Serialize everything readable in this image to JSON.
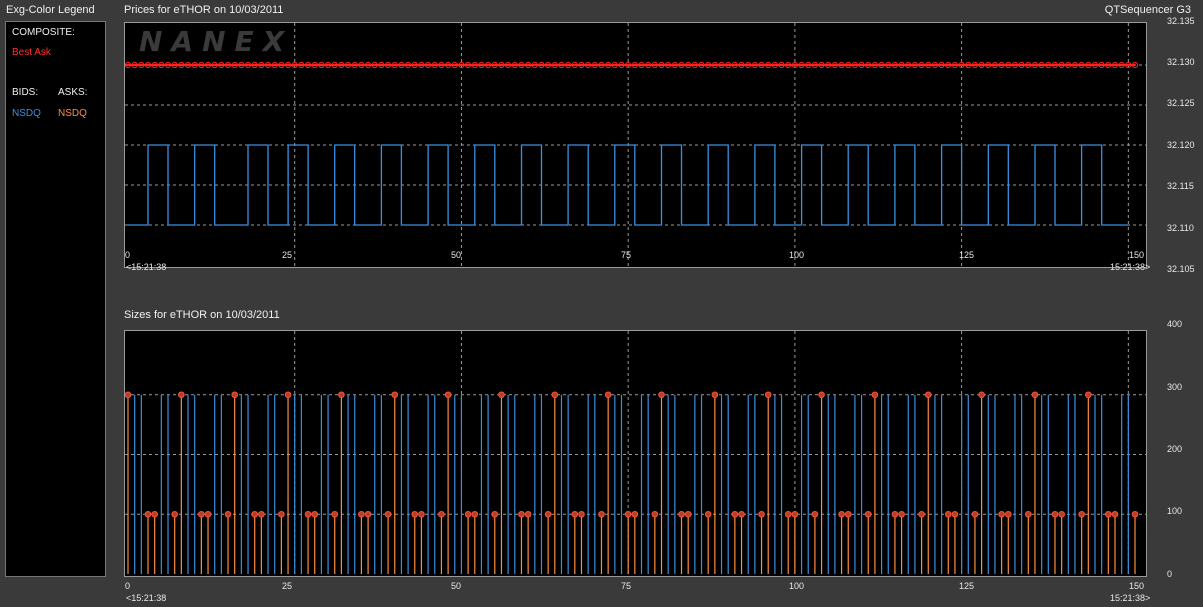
{
  "legend": {
    "title": "Exg-Color Legend",
    "composite_label": "COMPOSITE:",
    "best_ask": "Best Ask",
    "bids_label": "BIDS:",
    "asks_label": "ASKS:",
    "bid_exchange": "NSDQ",
    "ask_exchange": "NSDQ"
  },
  "header": {
    "price_title": "Prices for  eTHOR  on  10/03/2011",
    "app_name": "QTSequencer G3",
    "size_title": "Sizes for  eTHOR  on  10/03/2011"
  },
  "watermark": "NANEX",
  "time_start": "<15:21:38",
  "time_end": "15:21:38>",
  "colors": {
    "bid": "#3a8fe0",
    "ask": "#ff8c40",
    "best_ask": "#ff2020",
    "grid": "#9a9a9a",
    "background": "#000000"
  },
  "chart_data": [
    {
      "type": "line",
      "title": "Prices for  eTHOR  on  10/03/2011",
      "x_ticks": [
        "0",
        "25",
        "50",
        "75",
        "100",
        "125",
        "150"
      ],
      "xlim": [
        0,
        151
      ],
      "y_ticks": [
        "32.105",
        "32.110",
        "32.115",
        "32.120",
        "32.125",
        "32.130",
        "32.135"
      ],
      "ylim": [
        32.105,
        32.135
      ],
      "grid": true,
      "series": [
        {
          "name": "Best Ask",
          "kind": "constant",
          "value": 32.13,
          "markers": true
        },
        {
          "name": "NSDQ",
          "side": "bid",
          "kind": "step",
          "y": [
            32.11,
            32.11,
            32.11,
            32.12,
            32.12,
            32.12,
            32.11,
            32.11,
            32.11,
            32.11,
            32.12,
            32.12,
            32.12,
            32.11,
            32.11,
            32.11,
            32.11,
            32.11,
            32.12,
            32.12,
            32.12,
            32.11,
            32.11,
            32.11,
            32.12,
            32.12,
            32.12,
            32.11,
            32.11,
            32.11,
            32.11,
            32.12,
            32.12,
            32.12,
            32.11,
            32.11,
            32.11,
            32.11,
            32.12,
            32.12,
            32.12,
            32.11,
            32.11,
            32.11,
            32.11,
            32.12,
            32.12,
            32.12,
            32.11,
            32.11,
            32.11,
            32.11,
            32.12,
            32.12,
            32.12,
            32.11,
            32.11,
            32.11,
            32.11,
            32.12,
            32.12,
            32.12,
            32.11,
            32.11,
            32.11,
            32.11,
            32.12,
            32.12,
            32.12,
            32.11,
            32.11,
            32.11,
            32.11,
            32.12,
            32.12,
            32.12,
            32.11,
            32.11,
            32.11,
            32.11,
            32.12,
            32.12,
            32.12,
            32.11,
            32.11,
            32.11,
            32.11,
            32.12,
            32.12,
            32.12,
            32.11,
            32.11,
            32.11,
            32.11,
            32.12,
            32.12,
            32.12,
            32.11,
            32.11,
            32.11,
            32.11,
            32.12,
            32.12,
            32.12,
            32.11,
            32.11,
            32.11,
            32.11,
            32.12,
            32.12,
            32.12,
            32.11,
            32.11,
            32.11,
            32.11,
            32.12,
            32.12,
            32.12,
            32.11,
            32.11,
            32.11,
            32.11,
            32.12,
            32.12,
            32.12,
            32.11,
            32.11,
            32.11,
            32.11,
            32.12,
            32.12,
            32.12,
            32.11,
            32.11,
            32.11,
            32.11,
            32.12,
            32.12,
            32.12,
            32.11,
            32.11,
            32.11,
            32.11,
            32.12,
            32.12,
            32.12,
            32.11,
            32.11,
            32.11,
            32.11
          ]
        }
      ]
    },
    {
      "type": "bar",
      "title": "Sizes for  eTHOR  on  10/03/2011",
      "x_ticks": [
        "0",
        "25",
        "50",
        "75",
        "100",
        "125",
        "150"
      ],
      "xlim": [
        0,
        151
      ],
      "y_ticks": [
        "0",
        "100",
        "200",
        "300",
        "400"
      ],
      "ylim": [
        0,
        400
      ],
      "grid": true,
      "series": [
        {
          "name": "NSDQ",
          "side": "bid",
          "x": [
            1,
            2,
            5,
            6,
            9,
            10,
            13,
            14,
            17,
            18,
            21,
            22,
            25,
            26,
            29,
            30,
            33,
            34,
            37,
            38,
            41,
            42,
            45,
            46,
            49,
            50,
            53,
            54,
            57,
            58,
            61,
            62,
            65,
            66,
            69,
            70,
            73,
            74,
            77,
            78,
            81,
            82,
            85,
            86,
            89,
            90,
            93,
            94,
            97,
            98,
            101,
            102,
            105,
            106,
            109,
            110,
            113,
            114,
            117,
            118,
            121,
            122,
            125,
            126,
            129,
            130,
            133,
            134,
            137,
            138,
            141,
            142,
            145,
            146,
            149,
            150
          ],
          "value": 300
        },
        {
          "name": "NSDQ",
          "side": "ask",
          "x": [
            0,
            3,
            4,
            7,
            8,
            11,
            12,
            15,
            16,
            19,
            20,
            23,
            24,
            27,
            28,
            31,
            32,
            35,
            36,
            39,
            40,
            43,
            44,
            47,
            48,
            51,
            52,
            55,
            56,
            59,
            60,
            63,
            64,
            67,
            68,
            71,
            72,
            75,
            76,
            79,
            80,
            83,
            84,
            87,
            88,
            91,
            92,
            95,
            96,
            99,
            100,
            103,
            104,
            107,
            108,
            111,
            112,
            115,
            116,
            119,
            120,
            123,
            124,
            127,
            128,
            131,
            132,
            135,
            136,
            139,
            140,
            143,
            144,
            147,
            148,
            151
          ],
          "values_pattern": [
            300,
            100,
            100,
            100
          ],
          "markers": true
        }
      ]
    }
  ]
}
